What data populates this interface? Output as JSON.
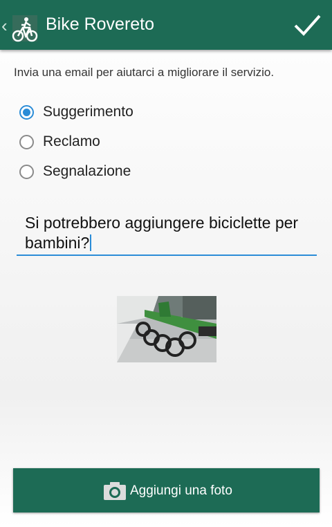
{
  "app_bar": {
    "title": "Bike Rovereto",
    "back_icon": "chevron-left-icon",
    "logo_icon": "bike-logo-icon",
    "confirm_icon": "checkmark-icon",
    "color": "#1d6b55"
  },
  "form": {
    "intro": "Invia una email per aiutarci a migliorare il servizio.",
    "options": [
      {
        "label": "Suggerimento",
        "checked": true
      },
      {
        "label": "Reclamo",
        "checked": false
      },
      {
        "label": "Segnalazione",
        "checked": false
      }
    ],
    "message": "Si potrebbero aggiungere biciclette per bambini?",
    "accent_color": "#2a8cd7"
  },
  "attachment": {
    "icon": "photo-thumbnail"
  },
  "footer": {
    "add_photo_label": "Aggiungi una foto",
    "camera_icon": "camera-icon"
  }
}
